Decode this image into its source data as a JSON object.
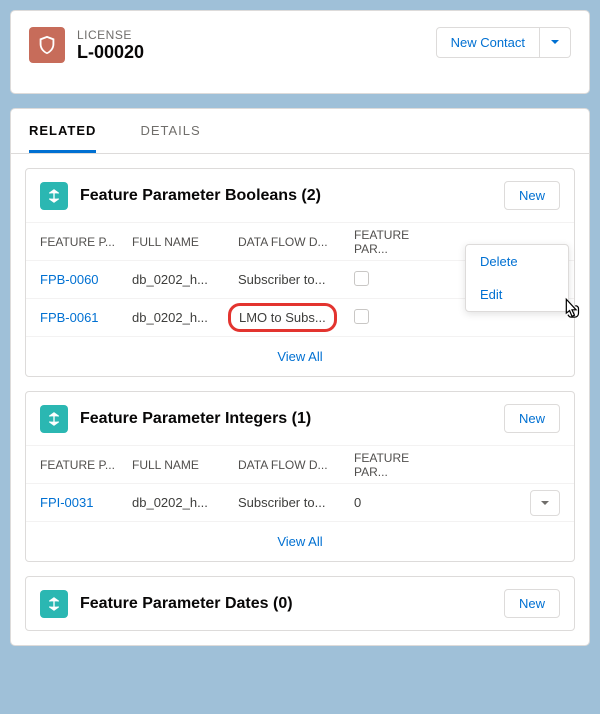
{
  "header": {
    "object_label": "LICENSE",
    "record_name": "L-00020",
    "primary_action": "New Contact"
  },
  "tabs": {
    "related": "RELATED",
    "details": "DETAILS"
  },
  "common": {
    "new_button": "New",
    "view_all": "View All",
    "menu_delete": "Delete",
    "menu_edit": "Edit"
  },
  "columns": {
    "feature_p": "FEATURE P...",
    "full_name": "FULL NAME",
    "data_flow": "DATA FLOW D...",
    "feature_par": "FEATURE PAR..."
  },
  "booleans": {
    "title": "Feature Parameter Booleans (2)",
    "rows": [
      {
        "id": "FPB-0060",
        "full_name": "db_0202_h...",
        "flow": "Subscriber to..."
      },
      {
        "id": "FPB-0061",
        "full_name": "db_0202_h...",
        "flow": "LMO to Subs..."
      }
    ]
  },
  "integers": {
    "title": "Feature Parameter Integers (1)",
    "rows": [
      {
        "id": "FPI-0031",
        "full_name": "db_0202_h...",
        "flow": "Subscriber to...",
        "value": "0"
      }
    ]
  },
  "dates": {
    "title": "Feature Parameter Dates (0)"
  }
}
